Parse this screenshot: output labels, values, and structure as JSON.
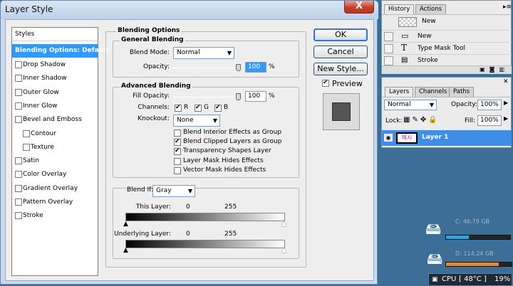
{
  "dialog": {
    "title": "Layer Style",
    "close_label": "X",
    "styles_list": {
      "header": "Styles",
      "selected": "Blending Options: Default",
      "items": [
        {
          "label": "Drop Shadow",
          "checked": false,
          "sub": false
        },
        {
          "label": "Inner Shadow",
          "checked": false,
          "sub": false
        },
        {
          "label": "Outer Glow",
          "checked": false,
          "sub": false
        },
        {
          "label": "Inner Glow",
          "checked": false,
          "sub": false
        },
        {
          "label": "Bevel and Emboss",
          "checked": false,
          "sub": false
        },
        {
          "label": "Contour",
          "checked": false,
          "sub": true
        },
        {
          "label": "Texture",
          "checked": false,
          "sub": true
        },
        {
          "label": "Satin",
          "checked": false,
          "sub": false
        },
        {
          "label": "Color Overlay",
          "checked": false,
          "sub": false
        },
        {
          "label": "Gradient Overlay",
          "checked": false,
          "sub": false
        },
        {
          "label": "Pattern Overlay",
          "checked": false,
          "sub": false
        },
        {
          "label": "Stroke",
          "checked": false,
          "sub": false
        }
      ]
    },
    "blending_options": {
      "title": "Blending Options",
      "general": {
        "title": "General Blending",
        "blend_mode_label": "Blend Mode:",
        "blend_mode_value": "Normal",
        "opacity_label": "Opacity:",
        "opacity_value": "100",
        "opacity_fraction": 1.0,
        "unit": "%"
      },
      "advanced": {
        "title": "Advanced Blending",
        "fill_opacity_label": "Fill Opacity:",
        "fill_opacity_value": "100",
        "fill_opacity_fraction": 1.0,
        "unit": "%",
        "channels_label": "Channels:",
        "channels": [
          {
            "label": "R",
            "checked": true
          },
          {
            "label": "G",
            "checked": true
          },
          {
            "label": "B",
            "checked": true
          }
        ],
        "knockout_label": "Knockout:",
        "knockout_value": "None",
        "options": [
          {
            "label": "Blend Interior Effects as Group",
            "checked": false
          },
          {
            "label": "Blend Clipped Layers as Group",
            "checked": true
          },
          {
            "label": "Transparency Shapes Layer",
            "checked": true
          },
          {
            "label": "Layer Mask Hides Effects",
            "checked": false
          },
          {
            "label": "Vector Mask Hides Effects",
            "checked": false
          }
        ]
      },
      "blend_if": {
        "label": "Blend If:",
        "value": "Gray",
        "this_layer_label": "This Layer:",
        "this_layer_min": "0",
        "this_layer_max": "255",
        "underlying_label": "Underlying Layer:",
        "underlying_min": "0",
        "underlying_max": "255"
      }
    },
    "buttons": {
      "ok": "OK",
      "cancel": "Cancel",
      "new_style": "New Style...",
      "preview_label": "Preview",
      "preview_checked": true
    }
  },
  "history_panel": {
    "tabs": [
      "History",
      "Actions"
    ],
    "snapshot_label": "New",
    "rows": [
      {
        "label": "New",
        "icon": "document-icon"
      },
      {
        "label": "Type Mask Tool",
        "icon": "type-mask-icon"
      },
      {
        "label": "Stroke",
        "icon": "stroke-icon"
      }
    ]
  },
  "layers_panel": {
    "tabs": [
      "Layers",
      "Channels",
      "Paths"
    ],
    "blend_mode": "Normal",
    "opacity_label": "Opacity:",
    "opacity_value": "100%",
    "lock_label": "Lock:",
    "fill_label": "Fill:",
    "fill_value": "100%",
    "layer_name": "Layer 1",
    "layer_thumb_text": "예시"
  },
  "desktop": {
    "drive1_text": "C: 46.79 GB",
    "drive1_usage": 0.35,
    "drive2_text": "D: 114.24 GB",
    "drive2_usage": 0.8,
    "cpu_label": "CPU",
    "cpu_temp": "[ 48°C ]",
    "cpu_usage": "19%"
  },
  "colors": {
    "selection": "#3399ff",
    "layer_selected": "#3d8ee4",
    "desktop": "#3c6e98",
    "drive1_bar": "#39a3d6",
    "drive2_bar": "#e8862a"
  }
}
